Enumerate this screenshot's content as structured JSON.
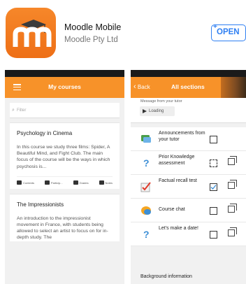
{
  "app": {
    "title": "Moodle Mobile",
    "developer": "Moodle Pty Ltd",
    "open_label": "OPEN",
    "open_plus": "+",
    "brand_color": "#f7882a",
    "link_color": "#2f7ff2"
  },
  "screen_left": {
    "nav_title": "My courses",
    "filter_placeholder": "Filter",
    "courses": [
      {
        "title": "Psychology in Cinema",
        "description": "In this course we study three films: Spider, A Beautiful Mind, and Fight Club. The main focus of the course will be the ways in which psychosis is...",
        "footer": [
          "Contents",
          "Particip...",
          "Grades",
          "Notes"
        ]
      },
      {
        "title": "The Impressionists",
        "description": "An introduction to the impressionist movement in France, with students being allowed to select an artist to focus on for in-depth study. The"
      }
    ]
  },
  "screen_right": {
    "back_label": "Back",
    "nav_title": "All sections",
    "tutor_label": "Message from your tutor",
    "loading_label": "Loading",
    "activities": [
      {
        "label": "Announcements from your tutor",
        "icon": "forum-icon",
        "checked": false,
        "copy": false
      },
      {
        "label": "Prior Knowledge assessment",
        "icon": "question-icon",
        "checked": false,
        "copy": true
      },
      {
        "label": "Factual recall test",
        "icon": "quiz-check-icon",
        "checked": true,
        "copy": true
      },
      {
        "label": "Course chat",
        "icon": "chat-icon",
        "checked": false,
        "copy": true
      },
      {
        "label": "Let's make a date!",
        "icon": "question-icon",
        "checked": false,
        "copy": true
      }
    ],
    "background_label": "Background information"
  }
}
